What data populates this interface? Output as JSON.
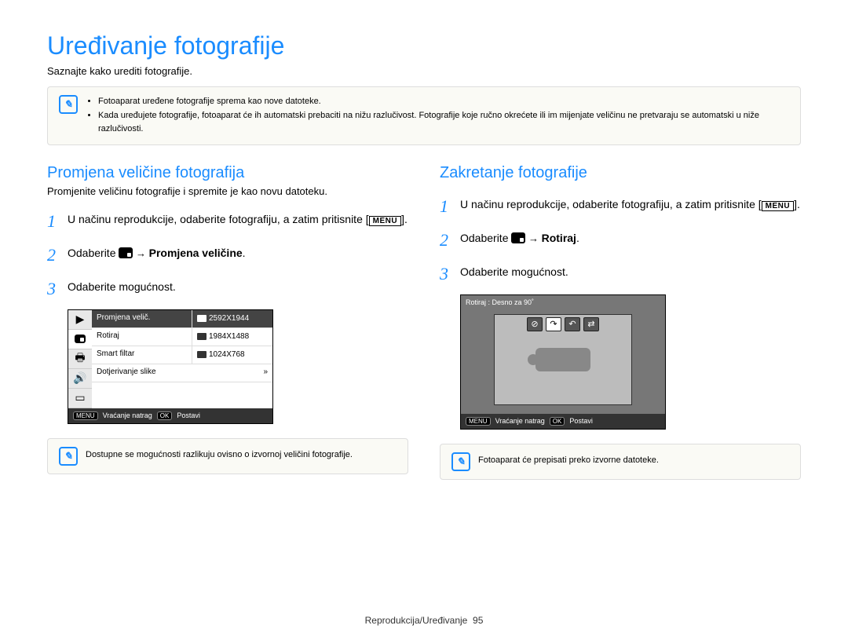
{
  "title": "Uređivanje fotografije",
  "subtitle": "Saznajte kako urediti fotografije.",
  "topnote": {
    "items": [
      "Fotoaparat uređene fotografije sprema kao nove datoteke.",
      "Kada uređujete fotografije, fotoaparat će ih automatski prebaciti na nižu razlučivost. Fotografije koje ručno okrećete ili im mijenjate veličinu ne pretvaraju se automatski u niže razlučivosti."
    ]
  },
  "left": {
    "heading": "Promjena veličine fotografija",
    "lead": "Promjenite veličinu fotografije i spremite je kao novu datoteku.",
    "step1": "U načinu reprodukcije, odaberite fotografiju, a zatim pritisnite [",
    "step1_end": "].",
    "step2_pre": "Odaberite ",
    "step2_arrow": " → ",
    "step2_bold": "Promjena veličine",
    "step2_post": ".",
    "step3": "Odaberite mogućnost.",
    "menu_label": "MENU",
    "cam": {
      "rows": [
        {
          "l": "Promjena velič.",
          "r": "2592X1944",
          "active": true
        },
        {
          "l": "Rotiraj",
          "r": "1984X1488"
        },
        {
          "l": "Smart filtar",
          "r": "1024X768"
        },
        {
          "l": "Dotjerivanje slike",
          "r": "",
          "arrow": true
        }
      ],
      "foot_back": "Vraćanje natrag",
      "foot_set": "Postavi",
      "foot_menu": "MENU",
      "foot_ok": "OK"
    },
    "note": "Dostupne se mogućnosti razlikuju ovisno o izvornoj veličini fotografije."
  },
  "right": {
    "heading": "Zakretanje fotografije",
    "step1": "U načinu reprodukcije, odaberite fotografiju, a zatim pritisnite [",
    "step1_end": "].",
    "step2_pre": "Odaberite ",
    "step2_arrow": " → ",
    "step2_bold": "Rotiraj",
    "step2_post": ".",
    "step3": "Odaberite mogućnost.",
    "menu_label": "MENU",
    "cam": {
      "top": "Rotiraj : Desno za 90˚",
      "foot_back": "Vraćanje natrag",
      "foot_set": "Postavi",
      "foot_menu": "MENU",
      "foot_ok": "OK"
    },
    "note": "Fotoaparat će prepisati preko izvorne datoteke."
  },
  "footer": {
    "text": "Reprodukcija/Uređivanje",
    "page": "95"
  }
}
